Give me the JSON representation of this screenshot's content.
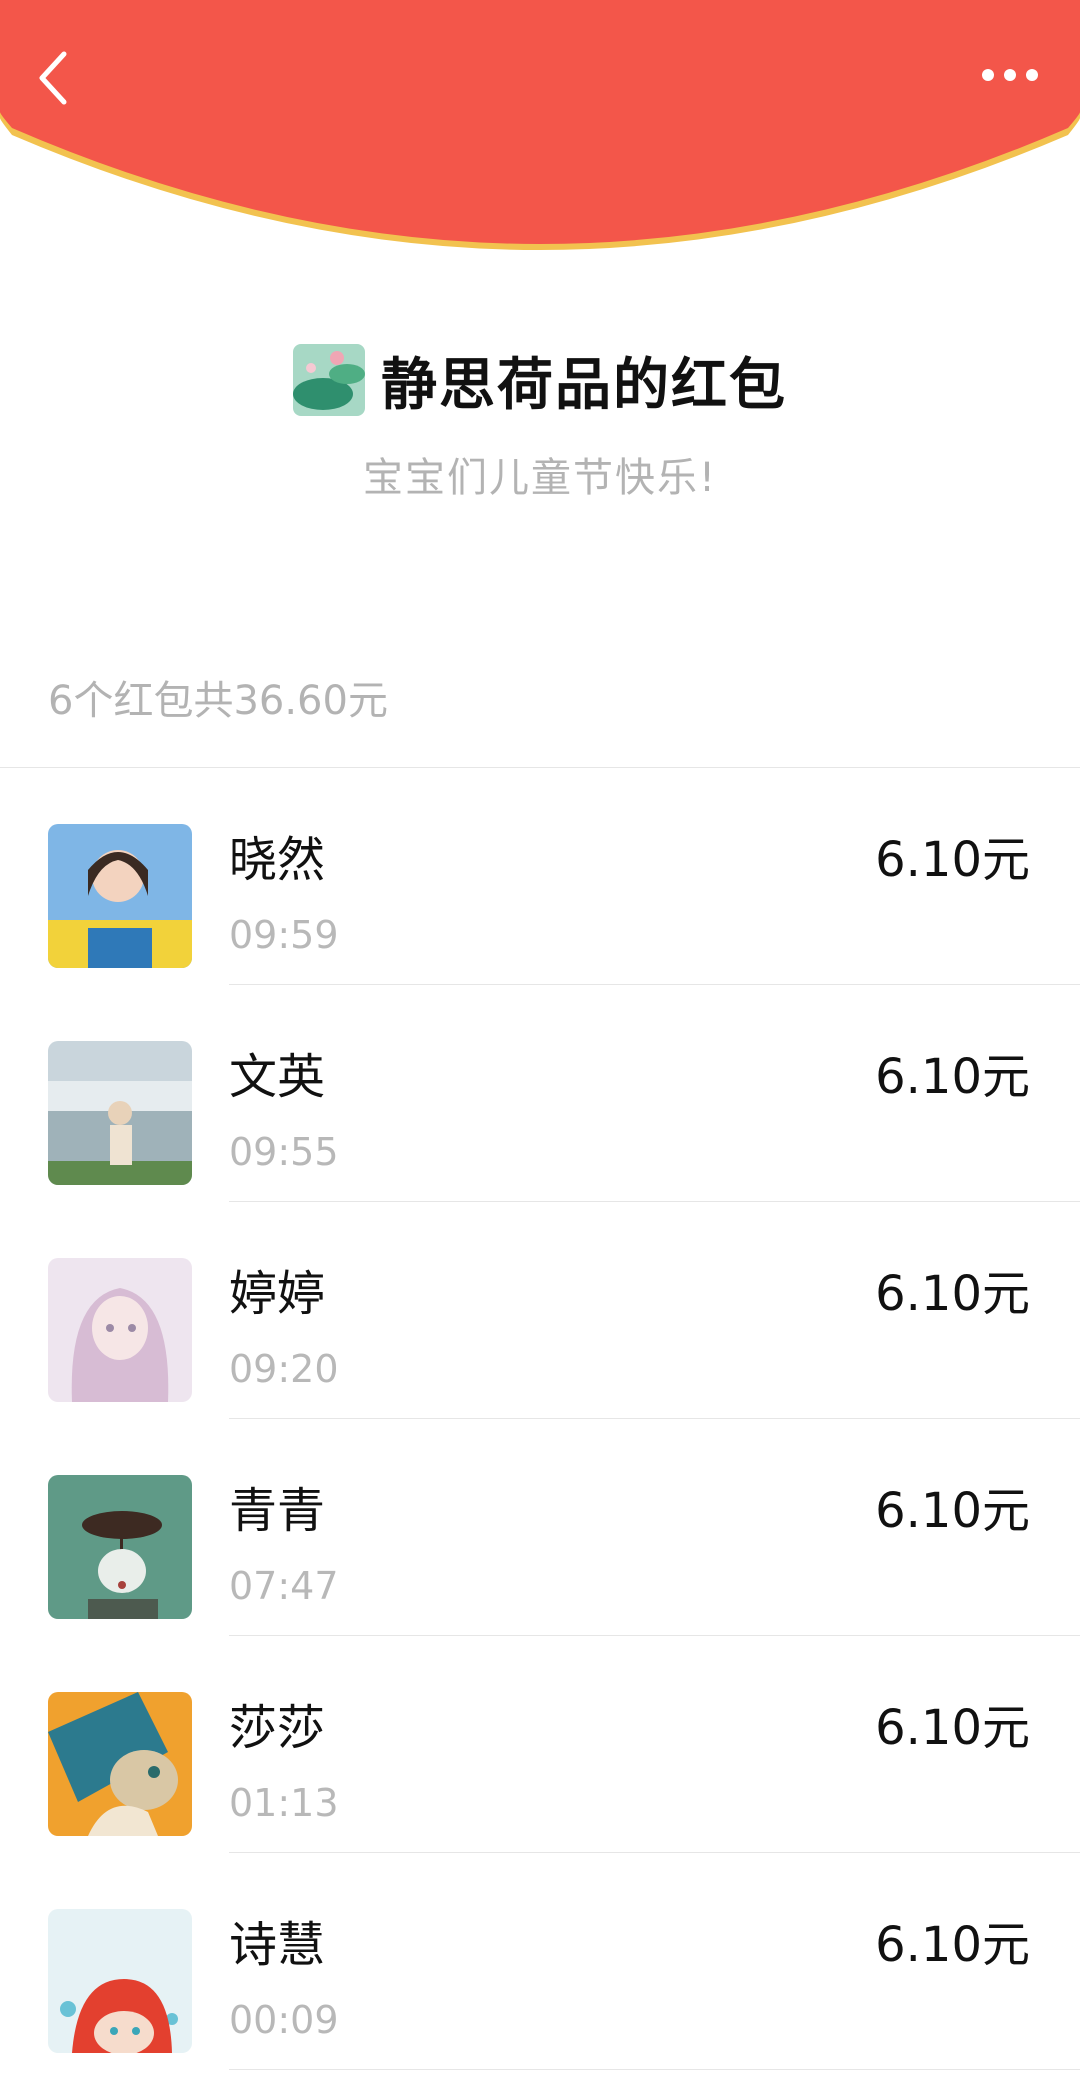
{
  "header": {
    "back_icon": "chevron-left-icon",
    "more_icon": "ellipsis-icon",
    "bg_color": "#f3564a",
    "rim_color": "#f2c24f"
  },
  "sender": {
    "name": "静思荷品的红包",
    "avatar_icon": "lotus-avatar",
    "blessing": "宝宝们儿童节快乐!"
  },
  "summary": "6个红包共36.60元",
  "receivers": [
    {
      "name": "晓然",
      "time": "09:59",
      "amount": "6.10元",
      "avatar_colors": [
        "#7fb6e6",
        "#f2d23a",
        "#3a2a22"
      ]
    },
    {
      "name": "文英",
      "time": "09:55",
      "amount": "6.10元",
      "avatar_colors": [
        "#c9d5dc",
        "#8aa37a",
        "#e8d2b9"
      ]
    },
    {
      "name": "婷婷",
      "time": "09:20",
      "amount": "6.10元",
      "avatar_colors": [
        "#eee5ef",
        "#d7bcd4",
        "#f6d9d9"
      ]
    },
    {
      "name": "青青",
      "time": "07:47",
      "amount": "6.10元",
      "avatar_colors": [
        "#5f9a87",
        "#dfe8e2",
        "#a6413c"
      ]
    },
    {
      "name": "莎莎",
      "time": "01:13",
      "amount": "6.10元",
      "avatar_colors": [
        "#f0a12e",
        "#2c7a8e",
        "#d9c7a5"
      ]
    },
    {
      "name": "诗慧",
      "time": "00:09",
      "amount": "6.10元",
      "avatar_colors": [
        "#e6f2f5",
        "#e3402f",
        "#69c2d6"
      ]
    }
  ]
}
